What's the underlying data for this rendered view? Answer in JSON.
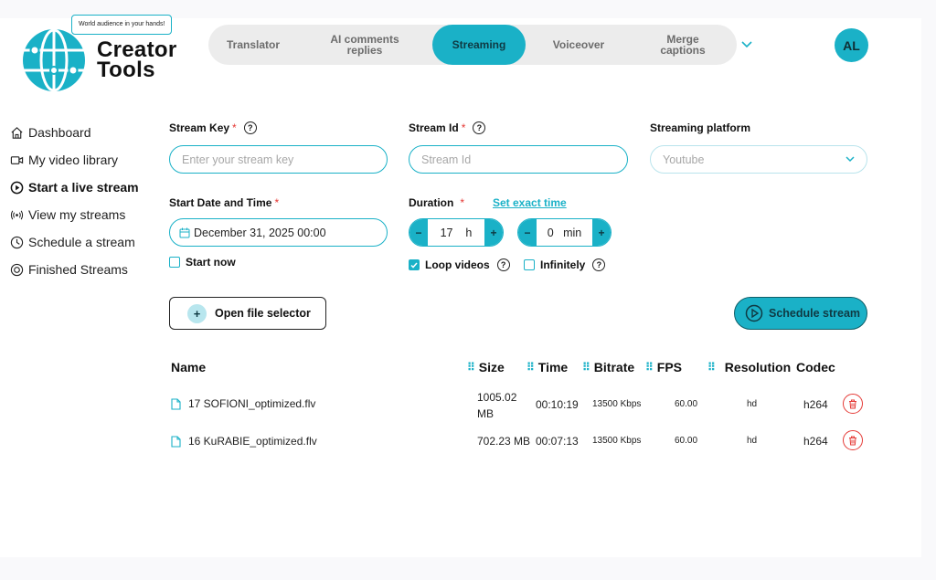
{
  "brand": {
    "tagline": "World audience in your hands!",
    "name_line1": "Creator",
    "name_line2": "Tools",
    "accent": "#1ab1c7"
  },
  "nav": {
    "tabs": [
      {
        "label": "Translator",
        "active": false
      },
      {
        "label": "AI comments\nreplies",
        "active": false
      },
      {
        "label": "Streaming",
        "active": true
      },
      {
        "label": "Voiceover",
        "active": false
      },
      {
        "label": "Merge\ncaptions",
        "active": false
      }
    ],
    "more_icon": "chevron-down-icon",
    "avatar": "AL"
  },
  "sidebar": {
    "items": [
      {
        "label": "Dashboard",
        "icon": "home-icon",
        "active": false
      },
      {
        "label": "My video library",
        "icon": "video-icon",
        "active": false
      },
      {
        "label": "Start a live stream",
        "icon": "play-circle-icon",
        "active": true
      },
      {
        "label": "View my streams",
        "icon": "broadcast-icon",
        "active": false
      },
      {
        "label": "Schedule a stream",
        "icon": "clock-icon",
        "active": false
      },
      {
        "label": "Finished Streams",
        "icon": "record-icon",
        "active": false
      }
    ]
  },
  "form": {
    "stream_key": {
      "label": "Stream Key",
      "required": "*",
      "placeholder": "Enter your stream key",
      "value": ""
    },
    "stream_id": {
      "label": "Stream Id",
      "required": "*",
      "placeholder": "Stream Id",
      "value": ""
    },
    "platform": {
      "label": "Streaming platform",
      "selected": "Youtube"
    },
    "start_date": {
      "label": "Start Date and Time",
      "required": "*",
      "value": "December 31, 2025 00:00"
    },
    "start_now": {
      "label": "Start now",
      "checked": false
    },
    "duration": {
      "label": "Duration",
      "required": "*",
      "set_exact_time": "Set exact time",
      "hours": {
        "value": "17",
        "unit": "h"
      },
      "minutes": {
        "value": "0",
        "unit": "min"
      },
      "minus": "−",
      "plus": "+"
    },
    "loop_videos": {
      "label": "Loop videos",
      "checked": true
    },
    "infinitely": {
      "label": "Infinitely",
      "checked": false
    },
    "help": "?",
    "open_file_selector": "Open file selector",
    "open_plus": "+",
    "schedule_stream": "Schedule stream"
  },
  "table": {
    "headers": {
      "name": "Name",
      "size": "Size",
      "time": "Time",
      "bitrate": "Bitrate",
      "fps": "FPS",
      "resolution": "Resolution",
      "codec": "Codec"
    },
    "rows": [
      {
        "name": "17 SOFIONI_optimized.flv",
        "size_line1": "1005.02",
        "size_line2": "MB",
        "time": "00:10:19",
        "bitrate": "13500 Kbps",
        "fps": "60.00",
        "resolution": "hd",
        "codec": "h264"
      },
      {
        "name": "16 KuRABIE_optimized.flv",
        "size_line1": "702.23 MB",
        "size_line2": "",
        "time": "00:07:13",
        "bitrate": "13500 Kbps",
        "fps": "60.00",
        "resolution": "hd",
        "codec": "h264"
      }
    ]
  }
}
